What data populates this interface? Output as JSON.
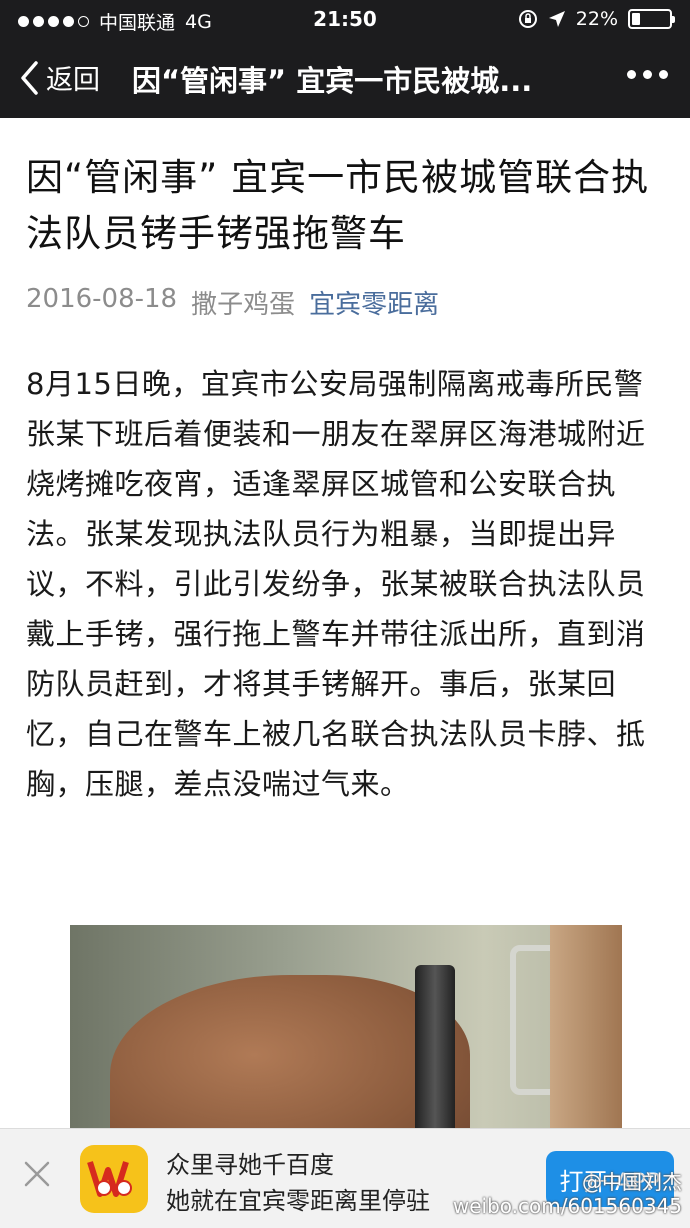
{
  "status_bar": {
    "carrier": "中国联通",
    "network": "4G",
    "time": "21:50",
    "battery": "22%",
    "battery_level": 0.22
  },
  "nav": {
    "back_label": "返回",
    "title": "因“管闲事” 宜宾一市民被城..."
  },
  "article": {
    "title": "因“管闲事” 宜宾一市民被城管联合执法队员铐手铐强拖警车",
    "date": "2016-08-18",
    "author": "撒子鸡蛋",
    "account": "宜宾零距离",
    "body": "8月15日晚，宜宾市公安局强制隔离戒毒所民警张某下班后着便装和一朋友在翠屏区海港城附近烧烤摊吃夜宵，适逢翠屏区城管和公安联合执法。张某发现执法队员行为粗暴，当即提出异议，不料，引此引发纷争，张某被联合执法队员戴上手铐，强行拖上警车并带往派出所，直到消防队员赶到，才将其手铐解开。事后，张某回忆，自己在警车上被几名联合执法队员卡脖、抵胸，压腿，差点没喘过气来。"
  },
  "banner": {
    "line1": "众里寻她千百度",
    "line2": "她就在宜宾零距离里停驻",
    "open_button": "打开 APP"
  },
  "watermark": {
    "handle": "@中国刘杰",
    "url": "weibo.com/601560345"
  }
}
